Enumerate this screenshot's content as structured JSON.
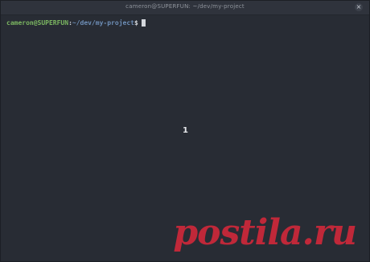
{
  "window": {
    "title": "cameron@SUPERFUN: ~/dev/my-project",
    "close_glyph": "×"
  },
  "terminal": {
    "prompt": {
      "user_host": "cameron@SUPERFUN",
      "separator": ":",
      "path": "~/dev/my-project",
      "symbol": "$"
    },
    "center_label": "1"
  },
  "watermark": {
    "text": "postila.ru"
  },
  "colors": {
    "background": "#282c34",
    "user_host": "#7bb661",
    "path": "#6e8fb8",
    "watermark": "#c9283a"
  }
}
